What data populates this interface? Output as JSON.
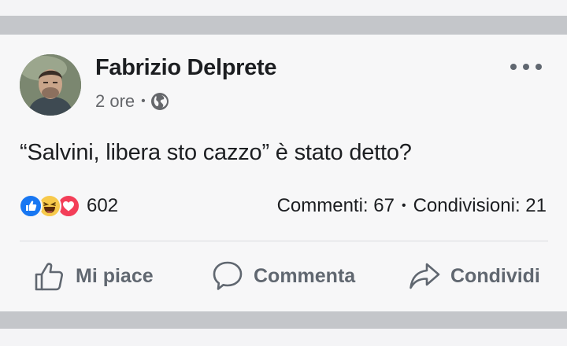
{
  "post": {
    "author": "Fabrizio Delprete",
    "time": "2 ore",
    "meta_separator": "•",
    "audience_icon": "globe-icon",
    "text": "“Salvini, libera sto cazzo” è stato detto?"
  },
  "engagement": {
    "reactions": [
      "like",
      "haha",
      "love"
    ],
    "reaction_count": "602",
    "comments": "Commenti: 67",
    "separator": "•",
    "shares": "Condivisioni: 21"
  },
  "actions": {
    "like_label": "Mi piace",
    "comment_label": "Commenta",
    "share_label": "Condividi"
  },
  "colors": {
    "like_blue": "#1877f2",
    "haha_yellow": "#f7c94b",
    "love_red": "#f33e58",
    "action_grey": "#606770",
    "divider_band": "#c4c6ca"
  }
}
